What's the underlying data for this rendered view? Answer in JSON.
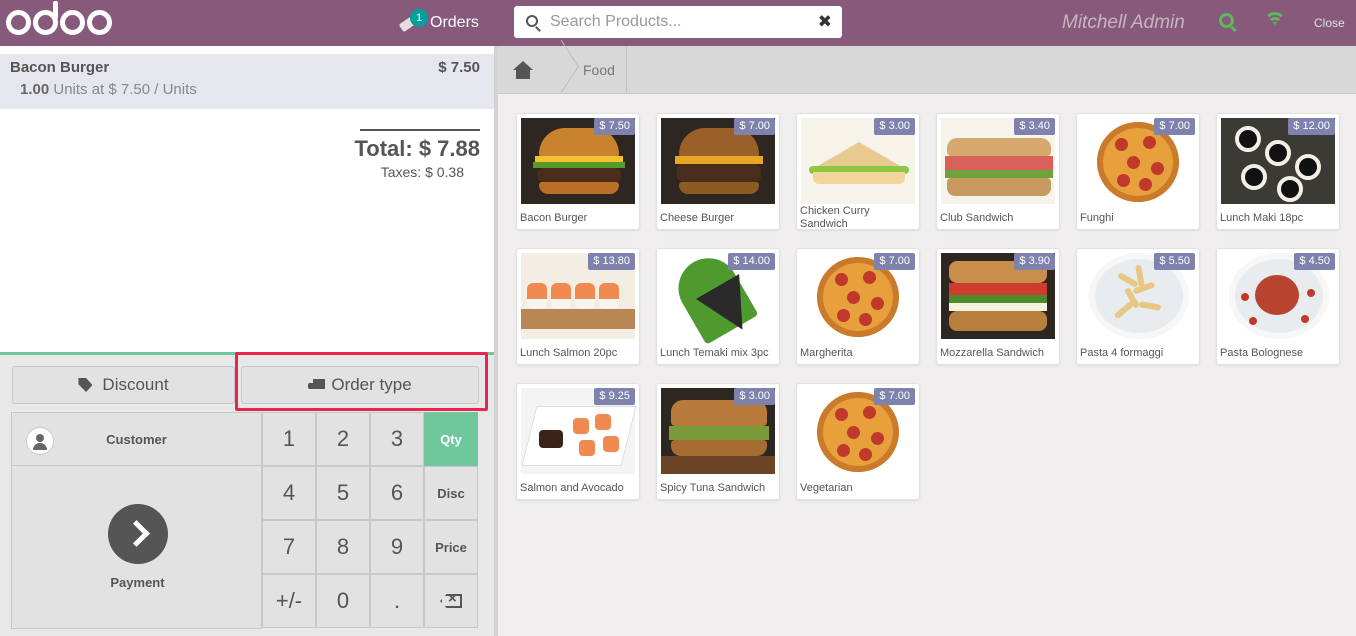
{
  "topbar": {
    "orders_label": "Orders",
    "orders_count": "1",
    "search_placeholder": "Search Products...",
    "clear_symbol": "✖",
    "user_name": "Mitchell Admin",
    "close_label": "Close"
  },
  "order": {
    "lines": [
      {
        "product": "Bacon Burger",
        "price": "$ 7.50",
        "quantity": "1.00",
        "unit_info": "Units at $ 7.50 / Units"
      }
    ],
    "total": "Total: $ 7.88",
    "taxes": "Taxes: $ 0.38"
  },
  "control_buttons": {
    "discount": "Discount",
    "order_type": "Order type"
  },
  "numpad": {
    "customer": "Customer",
    "payment": "Payment",
    "keys": [
      "1",
      "2",
      "3",
      "4",
      "5",
      "6",
      "7",
      "8",
      "9",
      "+/-",
      "0",
      "."
    ],
    "modes": [
      "Qty",
      "Disc",
      "Price"
    ],
    "active_mode": "Qty"
  },
  "breadcrumb": {
    "category": "Food"
  },
  "products": [
    {
      "name": "Bacon Burger",
      "price": "$ 7.50",
      "icon": "burger"
    },
    {
      "name": "Cheese Burger",
      "price": "$ 7.00",
      "icon": "burger-dark"
    },
    {
      "name": "Chicken Curry Sandwich",
      "price": "$ 3.00",
      "icon": "sandwich"
    },
    {
      "name": "Club Sandwich",
      "price": "$ 3.40",
      "icon": "club-sandwich"
    },
    {
      "name": "Funghi",
      "price": "$ 7.00",
      "icon": "pizza"
    },
    {
      "name": "Lunch Maki 18pc",
      "price": "$ 12.00",
      "icon": "maki"
    },
    {
      "name": "Lunch Salmon 20pc",
      "price": "$ 13.80",
      "icon": "salmon-sushi"
    },
    {
      "name": "Lunch Temaki mix 3pc",
      "price": "$ 14.00",
      "icon": "temaki"
    },
    {
      "name": "Margherita",
      "price": "$ 7.00",
      "icon": "pizza"
    },
    {
      "name": "Mozzarella Sandwich",
      "price": "$ 3.90",
      "icon": "mozzarella-sandwich"
    },
    {
      "name": "Pasta 4 formaggi",
      "price": "$ 5.50",
      "icon": "pasta"
    },
    {
      "name": "Pasta Bolognese",
      "price": "$ 4.50",
      "icon": "pasta-bolognese"
    },
    {
      "name": "Salmon and Avocado",
      "price": "$ 9.25",
      "icon": "salmon-avocado"
    },
    {
      "name": "Spicy Tuna Sandwich",
      "price": "$ 3.00",
      "icon": "tuna-sandwich"
    },
    {
      "name": "Vegetarian",
      "price": "$ 7.00",
      "icon": "pizza"
    }
  ],
  "colors": {
    "brand": "#875a7b",
    "accent_green": "#6ec89b",
    "price_tag": "#7f82ac",
    "highlight": "#e8254d",
    "online_status": "#5cb85c"
  }
}
